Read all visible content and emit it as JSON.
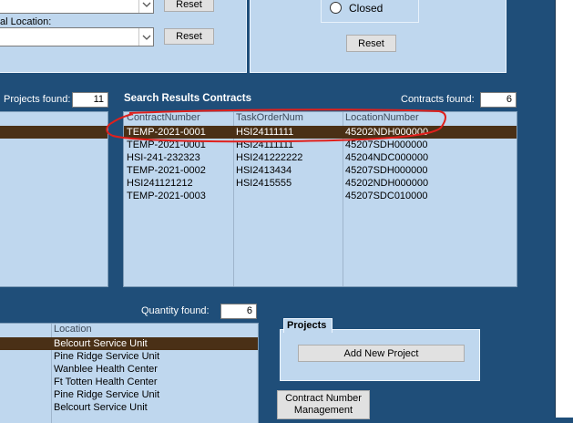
{
  "filter_panel": {
    "location_label": "al Location:",
    "reset_top": "Reset",
    "reset_location": "Reset"
  },
  "status_panel": {
    "closed_label": "Closed",
    "reset": "Reset"
  },
  "projects_found": {
    "label": "Projects found:",
    "count": "11"
  },
  "contracts": {
    "title": "Search Results Contracts",
    "found_label": "Contracts found:",
    "found_count": "6",
    "columns": [
      "ContractNumber",
      "TaskOrderNum",
      "LocationNumber"
    ],
    "rows": [
      [
        "TEMP-2021-0001",
        "HSI24111111",
        "45202NDH000000"
      ],
      [
        "TEMP-2021-0001",
        "HSI24111111",
        "45207SDH000000"
      ],
      [
        "HSI-241-232323",
        "HSI241222222",
        "45204NDC000000"
      ],
      [
        "TEMP-2021-0002",
        "HSI2413434",
        "45207SDH000000"
      ],
      [
        "HSI241121212",
        "HSI2415555",
        "45202NDH000000"
      ],
      [
        "TEMP-2021-0003",
        "",
        "45207SDC010000"
      ]
    ]
  },
  "quantity": {
    "label": "Quantity found:",
    "count": "6"
  },
  "locations": {
    "column": "Location",
    "rows": [
      "Belcourt Service Unit",
      "Pine Ridge Service Unit",
      "Wanblee Health Center",
      "Ft Totten Health Center",
      "Pine Ridge Service Unit",
      "Belcourt Service Unit"
    ]
  },
  "projects_box": {
    "title": "Projects",
    "add_button": "Add New Project"
  },
  "contract_mgmt_button": "Contract Number Management",
  "colors": {
    "background": "#1f4e79",
    "panel": "#bfd7ee",
    "selection": "#4a3016",
    "annotation": "#e0201c"
  }
}
